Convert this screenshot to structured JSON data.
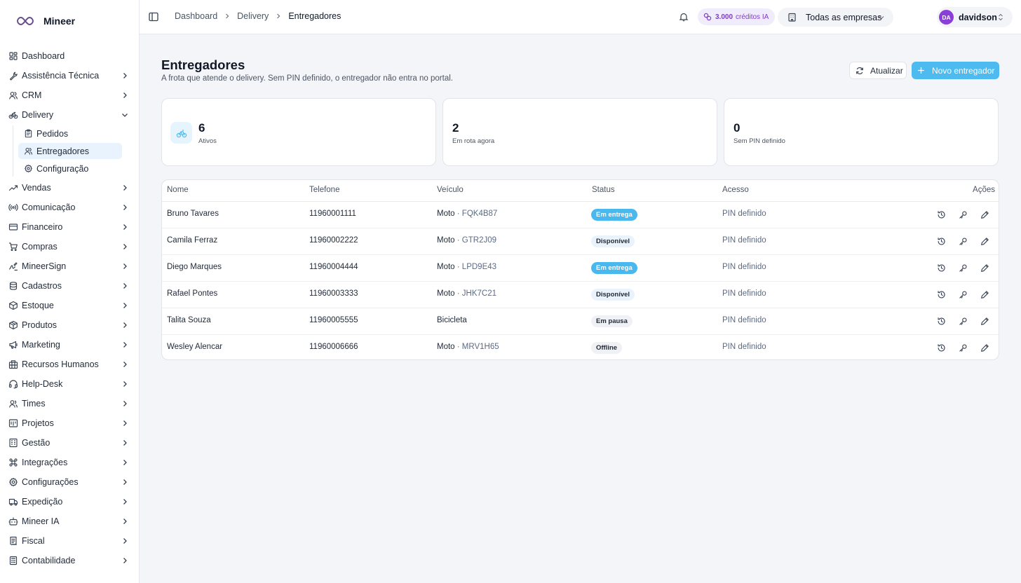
{
  "brand": {
    "name": "Mineer"
  },
  "sidebar": {
    "items": [
      {
        "label": "Dashboard",
        "icon": "dashboard-icon",
        "chevron": false
      },
      {
        "label": "Assistência Técnica",
        "icon": "wrench-icon",
        "chevron": true
      },
      {
        "label": "CRM",
        "icon": "users-icon",
        "chevron": true
      },
      {
        "label": "Delivery",
        "icon": "bike-icon",
        "chevron": true,
        "expanded": true
      },
      {
        "label": "Vendas",
        "icon": "trend-icon",
        "chevron": true
      },
      {
        "label": "Comunicação",
        "icon": "radio-icon",
        "chevron": true
      },
      {
        "label": "Financeiro",
        "icon": "card-icon",
        "chevron": true
      },
      {
        "label": "Compras",
        "icon": "cart-icon",
        "chevron": true
      },
      {
        "label": "MineerSign",
        "icon": "signature-icon",
        "chevron": true
      },
      {
        "label": "Cadastros",
        "icon": "database-icon",
        "chevron": true
      },
      {
        "label": "Estoque",
        "icon": "box-icon",
        "chevron": true
      },
      {
        "label": "Produtos",
        "icon": "package-icon",
        "chevron": true
      },
      {
        "label": "Marketing",
        "icon": "megaphone-icon",
        "chevron": true
      },
      {
        "label": "Recursos Humanos",
        "icon": "building-icon",
        "chevron": true
      },
      {
        "label": "Help-Desk",
        "icon": "headset-icon",
        "chevron": true
      },
      {
        "label": "Times",
        "icon": "team-icon",
        "chevron": true
      },
      {
        "label": "Projetos",
        "icon": "project-icon",
        "chevron": true
      },
      {
        "label": "Gestão",
        "icon": "office-icon",
        "chevron": true
      },
      {
        "label": "Integrações",
        "icon": "command-icon",
        "chevron": true
      },
      {
        "label": "Configurações",
        "icon": "gear-icon",
        "chevron": true
      },
      {
        "label": "Expedição",
        "icon": "truck-icon",
        "chevron": true
      },
      {
        "label": "Mineer IA",
        "icon": "bot-icon",
        "chevron": true
      },
      {
        "label": "Fiscal",
        "icon": "receipt-icon",
        "chevron": true
      },
      {
        "label": "Contabilidade",
        "icon": "calculator-icon",
        "chevron": true
      }
    ],
    "delivery_sub": [
      {
        "label": "Pedidos",
        "icon": "clipboard-icon",
        "active": false
      },
      {
        "label": "Entregadores",
        "icon": "users-icon",
        "active": true
      },
      {
        "label": "Configuração",
        "icon": "gear-icon",
        "active": false
      }
    ]
  },
  "topbar": {
    "breadcrumb": [
      "Dashboard",
      "Delivery",
      "Entregadores"
    ],
    "credits_value": "3.000",
    "credits_label": "créditos IA",
    "company": "Todas as empresas",
    "user_initials": "DA",
    "user_name": "davidson"
  },
  "page": {
    "title": "Entregadores",
    "subtitle": "A frota que atende o delivery. Sem PIN definido, o entregador não entra no portal.",
    "refresh_label": "Atualizar",
    "new_label": "Novo entregador"
  },
  "stats": [
    {
      "value": "6",
      "label": "Ativos"
    },
    {
      "value": "2",
      "label": "Em rota agora"
    },
    {
      "value": "0",
      "label": "Sem PIN definido"
    }
  ],
  "table": {
    "headers": {
      "name": "Nome",
      "phone": "Telefone",
      "vehicle": "Veículo",
      "status": "Status",
      "access": "Acesso",
      "actions": "Ações"
    },
    "rows": [
      {
        "name": "Bruno Tavares",
        "phone": "11960001111",
        "vehicle": "Moto",
        "plate": "· FQK4B87",
        "status": "Em entrega",
        "status_style": "blue",
        "access": "PIN definido"
      },
      {
        "name": "Camila Ferraz",
        "phone": "11960002222",
        "vehicle": "Moto",
        "plate": "· GTR2J09",
        "status": "Disponível",
        "status_style": "pale",
        "access": "PIN definido"
      },
      {
        "name": "Diego Marques",
        "phone": "11960004444",
        "vehicle": "Moto",
        "plate": "· LPD9E43",
        "status": "Em entrega",
        "status_style": "blue",
        "access": "PIN definido"
      },
      {
        "name": "Rafael Pontes",
        "phone": "11960003333",
        "vehicle": "Moto",
        "plate": "· JHK7C21",
        "status": "Disponível",
        "status_style": "pale",
        "access": "PIN definido"
      },
      {
        "name": "Talita Souza",
        "phone": "11960005555",
        "vehicle": "Bicicleta",
        "plate": "",
        "status": "Em pausa",
        "status_style": "gray",
        "access": "PIN definido"
      },
      {
        "name": "Wesley Alencar",
        "phone": "11960006666",
        "vehicle": "Moto",
        "plate": "· MRV1H65",
        "status": "Offline",
        "status_style": "gray",
        "access": "PIN definido"
      }
    ]
  },
  "colors": {
    "accent": "#4dbaf0",
    "credits": "#7b3fc4",
    "avatar": "#8b3fd9"
  }
}
